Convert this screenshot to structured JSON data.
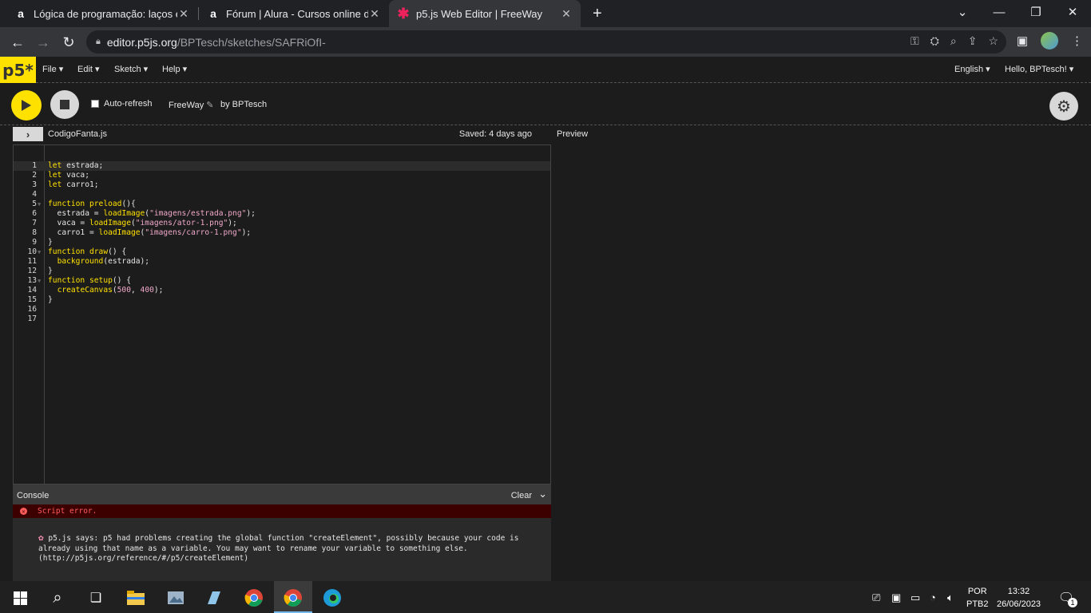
{
  "browser": {
    "tabs": [
      {
        "title": "Lógica de programação: laços e l",
        "favicon": "alura-icon"
      },
      {
        "title": "Fórum | Alura - Cursos online de",
        "favicon": "alura-icon"
      },
      {
        "title": "p5.js Web Editor | FreeWay",
        "favicon": "p5-asterisk-icon"
      }
    ],
    "new_tab": "+",
    "url_host": "editor.p5js.org",
    "url_path": "/BPTesch/sketches/SAFRiOfI-"
  },
  "p5": {
    "logo": "p5*",
    "menu": {
      "file": "File ▾",
      "edit": "Edit ▾",
      "sketch": "Sketch ▾",
      "help": "Help ▾"
    },
    "language": "English ▾",
    "greeting": "Hello, BPTesch! ▾",
    "autorefresh_label": "Auto-refresh",
    "sketch_name": "FreeWay",
    "byline": "by BPTesch",
    "file_name": "CodigoFanta.js",
    "saved_status": "Saved: 4 days ago",
    "preview_label": "Preview",
    "console_label": "Console",
    "clear_label": "Clear",
    "error_text": "Script error.",
    "console_message": "p5.js says: p5 had problems creating the global function \"createElement\", possibly because your code is already using that name as a variable. You may want to rename your variable to something else. (http://p5js.org/reference/#/p5/createElement)"
  },
  "code_lines": [
    "let estrada;",
    "let vaca;",
    "let carro1;",
    "",
    "function preload(){",
    "  estrada = loadImage(\"imagens/estrada.png\");",
    "  vaca = loadImage(\"imagens/ator-1.png\");",
    "  carro1 = loadImage(\"imagens/carro-1.png\");",
    "}",
    "function draw() {",
    "  background(estrada);",
    "}",
    "function setup() {",
    "  createCanvas(500, 400);",
    "}",
    "",
    ""
  ],
  "taskbar": {
    "lang_top": "POR",
    "lang_bottom": "PTB2",
    "time": "13:32",
    "date": "26/06/2023",
    "notifications": "1"
  }
}
